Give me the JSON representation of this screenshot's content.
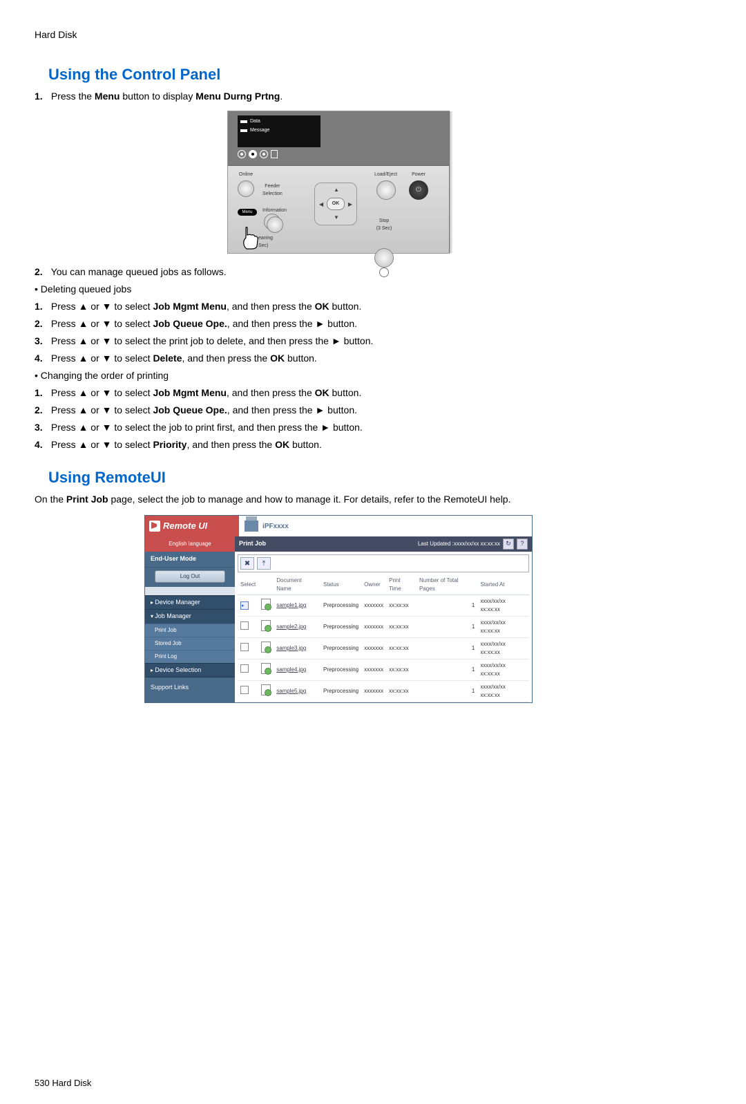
{
  "header": "Hard Disk",
  "section1_title": "Using the Control Panel",
  "s1_step1_num": "1.",
  "s1_step1_a": " Press the ",
  "s1_step1_b": "Menu",
  "s1_step1_c": " button to display ",
  "s1_step1_d": "Menu Durng Prtng",
  "s1_step1_e": ".",
  "panel": {
    "data": "Data",
    "message": "Message",
    "online": "Online",
    "feeder": "Feeder\nSelection",
    "load": "Load/Eject",
    "power": "Power",
    "menu": "Menu",
    "info": "Information",
    "ok": "OK",
    "stop": "Stop\n(3 Sec)",
    "cleaning": "eaning\nSec)"
  },
  "s1_step2_num": "2.",
  "s1_step2_text": " You can manage queued jobs as follows.",
  "del_title": "Deleting queued jobs",
  "del1_num": "1.",
  "del1_a": " Press ▲ or ▼ to select ",
  "del1_b": "Job Mgmt Menu",
  "del1_c": ", and then press the ",
  "del1_d": "OK",
  "del1_e": " button.",
  "del2_num": "2.",
  "del2_a": " Press ▲ or ▼ to select ",
  "del2_b": "Job Queue Ope.",
  "del2_c": ", and then press the ► button.",
  "del3_num": "3.",
  "del3_a": " Press ▲ or ▼ to select the print job to delete, and then press the ► button.",
  "del4_num": "4.",
  "del4_a": " Press ▲ or ▼ to select ",
  "del4_b": "Delete",
  "del4_c": ", and then press the ",
  "del4_d": "OK",
  "del4_e": " button.",
  "chg_title": "Changing the order of printing",
  "chg1_num": "1.",
  "chg1_a": " Press ▲ or ▼ to select ",
  "chg1_b": "Job Mgmt Menu",
  "chg1_c": ", and then press the ",
  "chg1_d": "OK",
  "chg1_e": " button.",
  "chg2_num": "2.",
  "chg2_a": " Press ▲ or ▼ to select ",
  "chg2_b": "Job Queue Ope.",
  "chg2_c": ", and then press the ► button.",
  "chg3_num": "3.",
  "chg3_a": " Press ▲ or ▼ to select the job to print first, and then press the ► button.",
  "chg4_num": "4.",
  "chg4_a": " Press ▲ or ▼ to select ",
  "chg4_b": "Priority",
  "chg4_c": ", and then press the ",
  "chg4_d": "OK",
  "chg4_e": " button.",
  "section2_title": "Using RemoteUI",
  "s2_intro_a": "On the ",
  "s2_intro_b": "Print Job",
  "s2_intro_c": " page, select the job to manage and how to manage it.  For details, refer to the RemoteUI help.",
  "ru": {
    "title": "Remote UI",
    "device": "iPFxxxx",
    "lang": "English language",
    "bar": "Print Job",
    "updated": "Last Updated :xxxx/xx/xx xx:xx:xx",
    "mode": "End-User Mode",
    "logout": "Log Out",
    "nav_devmgr": "Device Manager",
    "nav_jobmgr": "Job Manager",
    "nav_printjob": "Print Job",
    "nav_storedjob": "Stored Job",
    "nav_printlog": "Print Log",
    "nav_devsel": "Device Selection",
    "nav_support": "Support Links",
    "th_select": "Select",
    "th_doc": "Document Name",
    "th_status": "Status",
    "th_owner": "Owner",
    "th_ptime": "Print Time",
    "th_pages": "Number of Total Pages",
    "th_started": "Started At",
    "rows": [
      {
        "sel": true,
        "doc": "sample1.jpg",
        "status": "Preprocessing",
        "owner": "xxxxxxx",
        "ptime": "xx:xx:xx",
        "pages": "1",
        "started": "xxxx/xx/xx xx:xx:xx"
      },
      {
        "sel": false,
        "doc": "sample2.jpg",
        "status": "Preprocessing",
        "owner": "xxxxxxx",
        "ptime": "xx:xx:xx",
        "pages": "1",
        "started": "xxxx/xx/xx xx:xx:xx"
      },
      {
        "sel": false,
        "doc": "sample3.jpg",
        "status": "Preprocessing",
        "owner": "xxxxxxx",
        "ptime": "xx:xx:xx",
        "pages": "1",
        "started": "xxxx/xx/xx xx:xx:xx"
      },
      {
        "sel": false,
        "doc": "sample4.jpg",
        "status": "Preprocessing",
        "owner": "xxxxxxx",
        "ptime": "xx:xx:xx",
        "pages": "1",
        "started": "xxxx/xx/xx xx:xx:xx"
      },
      {
        "sel": false,
        "doc": "sample5.jpg",
        "status": "Preprocessing",
        "owner": "xxxxxxx",
        "ptime": "xx:xx:xx",
        "pages": "1",
        "started": "xxxx/xx/xx xx:xx:xx"
      }
    ]
  },
  "footer_page": "530",
  "footer_text": "  Hard Disk"
}
